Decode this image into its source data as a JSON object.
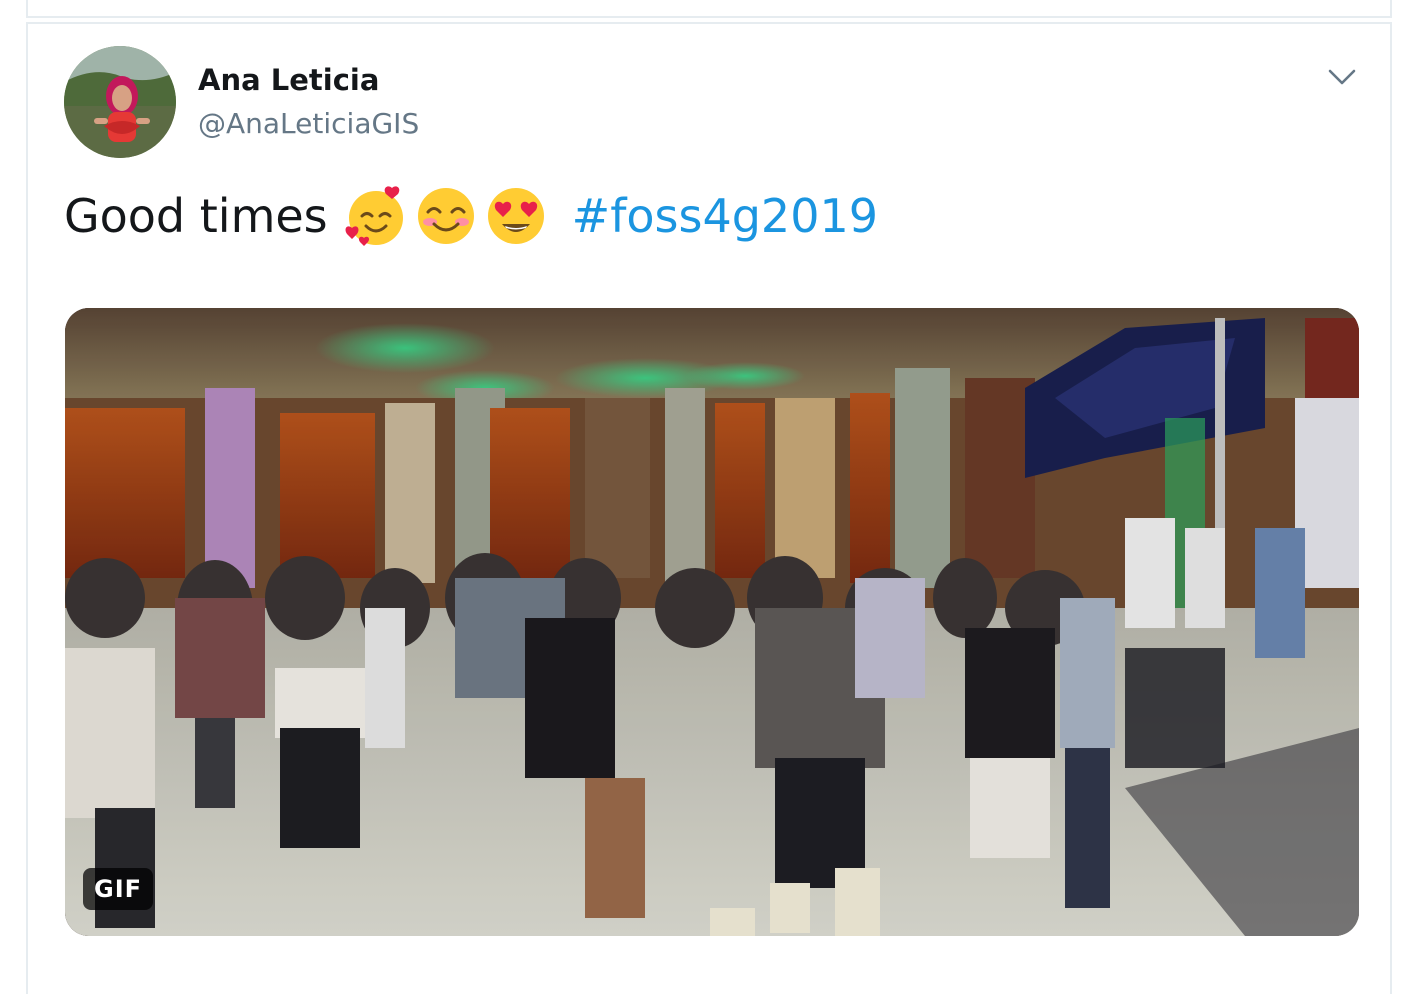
{
  "tweet": {
    "author_name": "Ana Leticia",
    "author_handle": "@AnaLeticiaGIS",
    "text_prefix": "Good times",
    "emojis": [
      "smiling-face-with-hearts-icon",
      "smiling-face-with-smiling-eyes-icon",
      "heart-eyes-icon"
    ],
    "hashtag": "#foss4g2019",
    "media_badge": "GIF"
  },
  "colors": {
    "text": "#14171a",
    "secondary_text": "#657786",
    "link": "#1b95e0",
    "border": "#e6ecf0"
  }
}
